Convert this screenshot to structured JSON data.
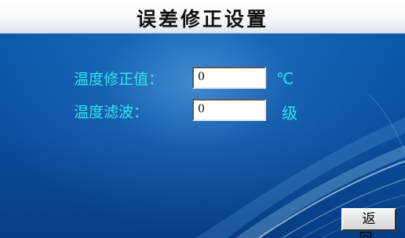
{
  "header": {
    "title": "误差修正设置"
  },
  "settings": {
    "temp_correction": {
      "label": "温度修正值：",
      "value": "0",
      "unit": "℃"
    },
    "temp_filter": {
      "label": "温度滤波：",
      "value": "0",
      "unit": "级"
    }
  },
  "footer": {
    "back_label": "返 回"
  },
  "colors": {
    "label_text": "#2ee6f0",
    "background": "#0b4f9e",
    "title_bar": "#ffffff"
  }
}
